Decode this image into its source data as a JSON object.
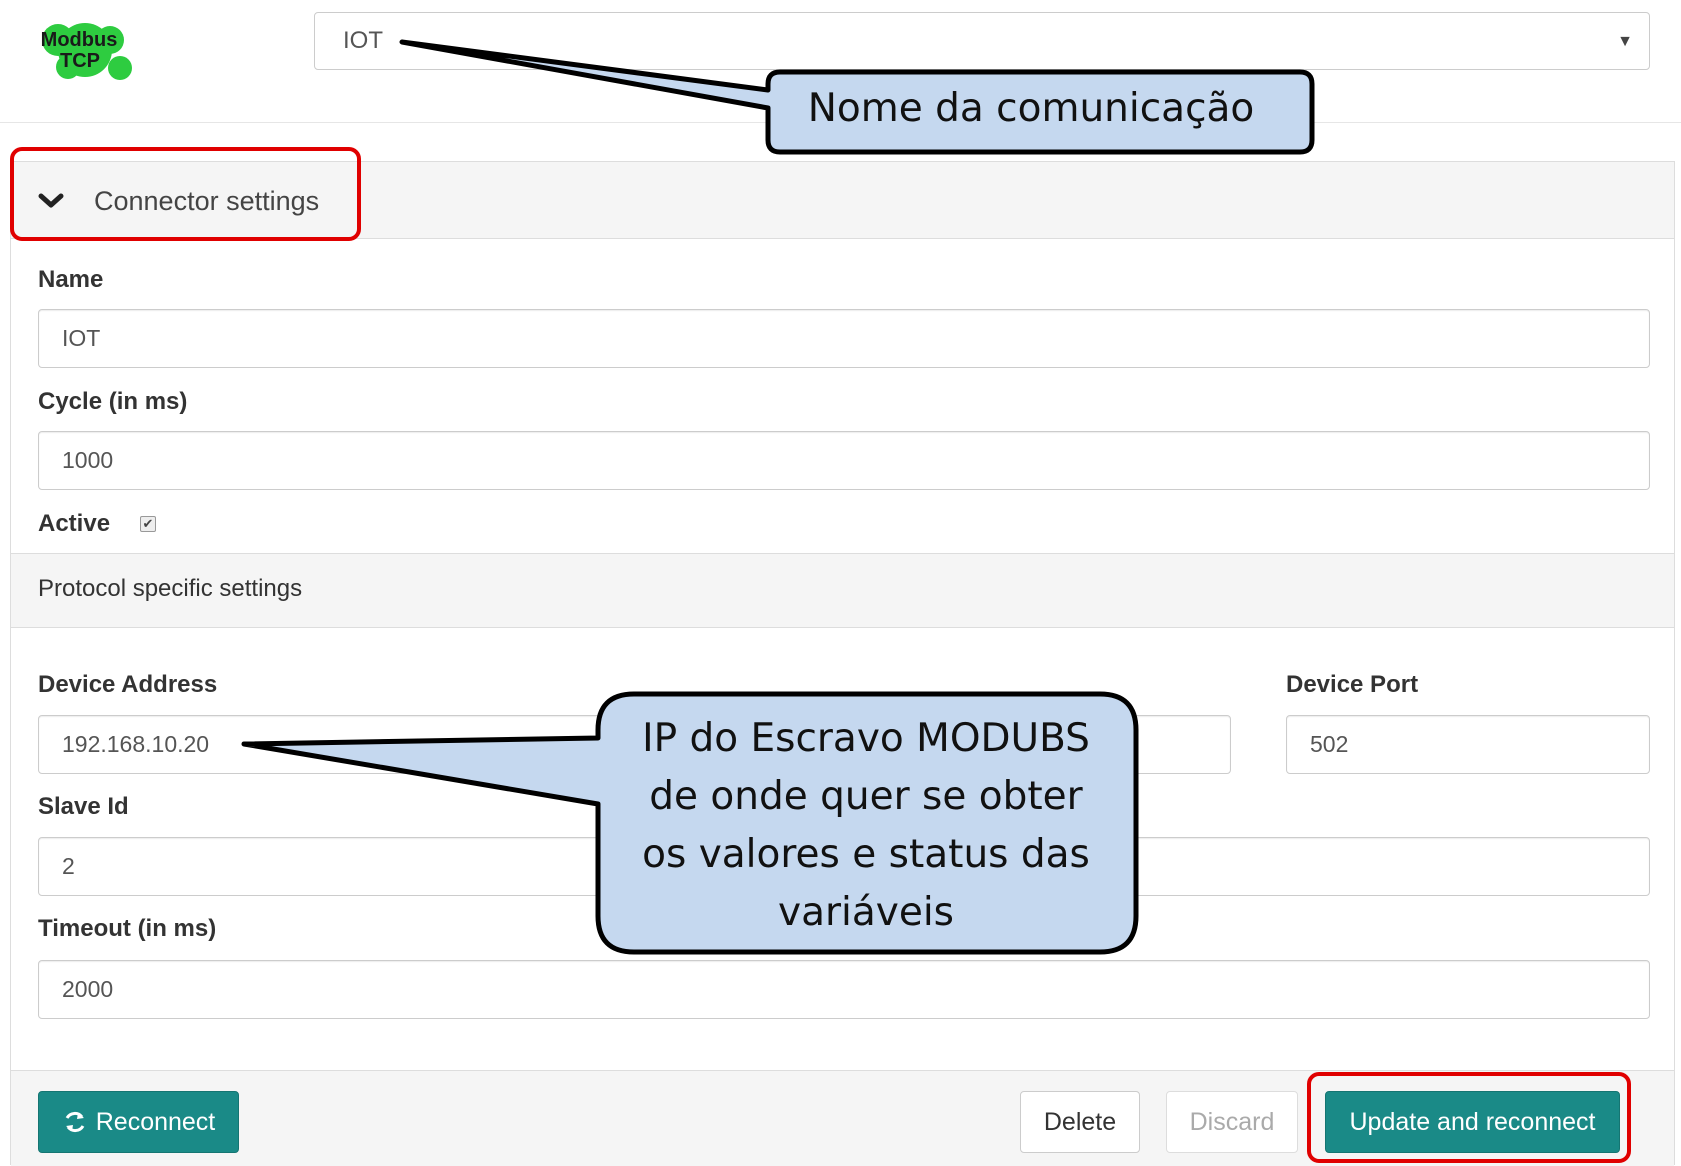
{
  "header": {
    "logo": {
      "line1": "Modbus",
      "line2": "TCP"
    },
    "connection_select": {
      "value": "IOT"
    }
  },
  "panel": {
    "title": "Connector settings",
    "fields": {
      "name": {
        "label": "Name",
        "value": "IOT"
      },
      "cycle": {
        "label": "Cycle (in ms)",
        "value": "1000"
      },
      "active": {
        "label": "Active",
        "checked": true
      }
    },
    "protocol_section": {
      "title": "Protocol specific settings",
      "device_address": {
        "label": "Device Address",
        "value": "192.168.10.20"
      },
      "device_port": {
        "label": "Device Port",
        "value": "502"
      },
      "slave_id": {
        "label": "Slave Id",
        "value": "2"
      },
      "timeout": {
        "label": "Timeout (in ms)",
        "value": "2000"
      }
    }
  },
  "footer": {
    "reconnect": "Reconnect",
    "delete": "Delete",
    "discard": "Discard",
    "update": "Update and reconnect"
  },
  "annotations": {
    "callout1": "Nome da comunicação",
    "callout2_lines": [
      "IP do Escravo MODUBS",
      "de onde quer se obter",
      "os valores e status das",
      "variáveis"
    ]
  },
  "colors": {
    "accent": "#1a8a87",
    "callout_fill": "#c5d8ef",
    "highlight": "#e00000",
    "logo_green": "#2ecc40"
  },
  "icons": [
    "chevron-down-icon",
    "refresh-icon",
    "caret-down-icon",
    "checkmark-icon",
    "modbus-logo-icon"
  ]
}
